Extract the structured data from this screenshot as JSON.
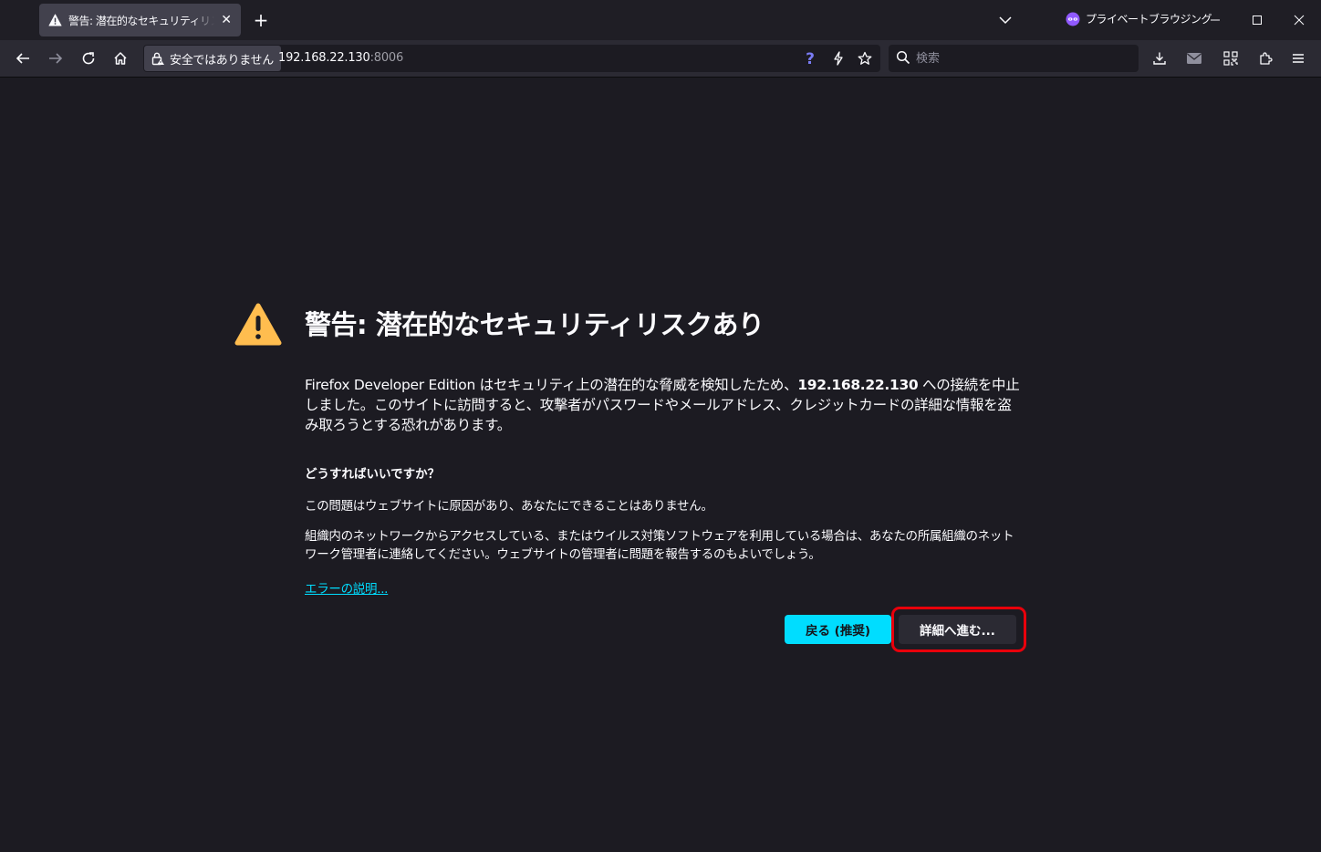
{
  "browser": {
    "tab": {
      "title": "警告: 潜在的なセキュリティリスクあり",
      "icon": "warning-icon"
    },
    "private_label": "プライベートブラウジング",
    "identity_label": "安全ではありません",
    "url": {
      "host": "192.168.22.130",
      "port": ":8006"
    },
    "search_placeholder": "検索",
    "colors": {
      "accent": "#00ddff",
      "private": "#9059ff",
      "warning": "#ffbd4f",
      "highlight": "#e8000b"
    }
  },
  "page": {
    "title": "警告: 潜在的なセキュリティリスクあり",
    "intro_before": "Firefox Developer Edition はセキュリティ上の潜在的な脅威を検知したため、",
    "intro_host": "192.168.22.130",
    "intro_after": " への接続を中止しました。このサイトに訪問すると、攻撃者がパスワードやメールアドレス、クレジットカードの詳細な情報を盗み取ろうとする恐れがあります。",
    "what_heading": "どうすればいいですか？",
    "what_p1": "この問題はウェブサイトに原因があり、あなたにできることはありません。",
    "what_p2": "組織内のネットワークからアクセスしている、またはウイルス対策ソフトウェアを利用している場合は、あなたの所属組織のネットワーク管理者に連絡してください。ウェブサイトの管理者に問題を報告するのもよいでしょう。",
    "learn_more": "エラーの説明...",
    "back_button": "戻る (推奨)",
    "advanced_button": "詳細へ進む..."
  }
}
